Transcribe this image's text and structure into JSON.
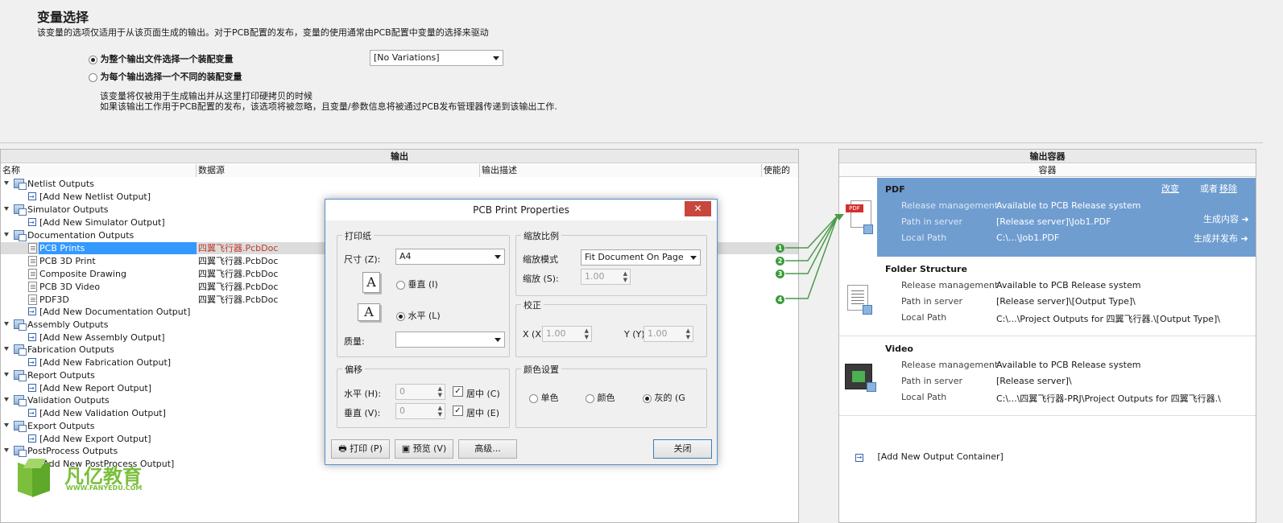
{
  "variant": {
    "title": "变量选择",
    "subtitle": "该变量的选项仅适用于从该页面生成的输出。对于PCB配置的发布，变量的使用通常由PCB配置中变量的选择来驱动",
    "option1": "为整个输出文件选择一个装配变量",
    "option2": "为每个输出选择一个不同的装配变量",
    "combo_value": "[No Variations]",
    "note1": "该变量将仅被用于生成输出并从这里打印硬拷贝的时候",
    "note2": "如果该输出工作用于PCB配置的发布，该选项将被忽略，且变量/参数信息将被通过PCB发布管理器传递到该输出工作."
  },
  "outputs": {
    "title": "输出",
    "columns": [
      "名称",
      "数据源",
      "输出描述",
      "使能的"
    ],
    "groups": [
      {
        "label": "Netlist Outputs",
        "add": "[Add New Netlist Output]"
      },
      {
        "label": "Simulator Outputs",
        "add": "[Add New Simulator Output]"
      },
      {
        "label": "Documentation Outputs",
        "add": "[Add New Documentation Output]"
      },
      {
        "label": "Assembly Outputs",
        "add": "[Add New Assembly Output]"
      },
      {
        "label": "Fabrication Outputs",
        "add": "[Add New Fabrication Output]"
      },
      {
        "label": "Report Outputs",
        "add": "[Add New Report Output]"
      },
      {
        "label": "Validation Outputs",
        "add": "[Add New Validation Output]"
      },
      {
        "label": "Export Outputs",
        "add": "[Add New Export Output]"
      },
      {
        "label": "PostProcess Outputs",
        "add": "[Add New PostProcess Output]"
      }
    ],
    "doc_items": [
      {
        "name": "PCB Prints",
        "source": "四翼飞行器.PcbDoc",
        "badge": "1"
      },
      {
        "name": "PCB 3D Print",
        "source": "四翼飞行器.PcbDoc",
        "badge": "2"
      },
      {
        "name": "Composite Drawing",
        "source": "四翼飞行器.PcbDoc",
        "badge": "3"
      },
      {
        "name": "PCB 3D Video",
        "source": "四翼飞行器.PcbDoc",
        "badge": ""
      },
      {
        "name": "PDF3D",
        "source": "四翼飞行器.PcbDoc",
        "badge": "4"
      }
    ]
  },
  "containers": {
    "title": "输出容器",
    "subtitle": "容器",
    "items": [
      {
        "name": "PDF",
        "rm_label": "Release management",
        "rm_value": "Available to PCB Release system",
        "ps_label": "Path in server",
        "ps_value": "[Release server]\\Job1.PDF",
        "lp_label": "Local Path",
        "lp_value": "C:\\...\\Job1.PDF",
        "change": "改变",
        "or": "或者",
        "remove": "移除",
        "generate": "生成内容",
        "gen_publish": "生成并发布",
        "icon_text": "PDF"
      },
      {
        "name": "Folder Structure",
        "rm_label": "Release management",
        "rm_value": "Available to PCB Release system",
        "ps_label": "Path in server",
        "ps_value": "[Release server]\\[Output Type]\\",
        "lp_label": "Local Path",
        "lp_value": "C:\\...\\Project Outputs for 四翼飞行器.\\[Output Type]\\"
      },
      {
        "name": "Video",
        "rm_label": "Release management",
        "rm_value": "Available to PCB Release system",
        "ps_label": "Path in server",
        "ps_value": "[Release server]\\",
        "lp_label": "Local Path",
        "lp_value": "C:\\...\\四翼飞行器-PRJ\\Project Outputs for 四翼飞行器.\\"
      }
    ],
    "add_new": "[Add New Output Container]"
  },
  "dialog": {
    "title": "PCB Print Properties",
    "paper": {
      "label": "打印纸",
      "size_label": "尺寸 (Z):",
      "size_value": "A4",
      "portrait": "垂直 (I)",
      "landscape": "水平 (L)",
      "quality_label": "质量:",
      "quality_value": ""
    },
    "scale": {
      "label": "缩放比例",
      "mode_label": "缩放模式",
      "mode_value": "Fit Document On Page",
      "scale_label": "缩放 (S):",
      "scale_value": "1.00"
    },
    "correction": {
      "label": "校正",
      "x_label": "X (X)",
      "x_value": "1.00",
      "y_label": "Y (Y)",
      "y_value": "1.00"
    },
    "offset": {
      "label": "偏移",
      "h_label": "水平 (H):",
      "h_value": "0",
      "v_label": "垂直 (V):",
      "v_value": "0",
      "center_c": "居中 (C)",
      "center_e": "居中 (E)"
    },
    "color": {
      "label": "颜色设置",
      "mono": "单色",
      "color": "颜色",
      "gray": "灰的 (G"
    },
    "buttons": {
      "print": "打印 (P)",
      "preview": "预览 (V)",
      "advanced": "高级...",
      "close": "关闭"
    },
    "close_x": "✕"
  },
  "watermark": {
    "brand": "凡亿教育",
    "url": "WWW.FANYEDU.COM"
  }
}
